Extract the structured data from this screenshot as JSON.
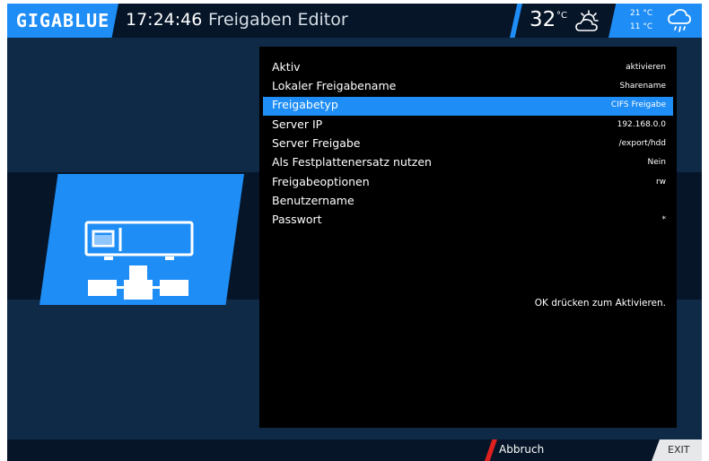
{
  "header": {
    "logo": "GIGABLUE",
    "clock": "17:24:46",
    "title": "Freigaben Editor",
    "temperature": "32",
    "temperature_unit": "°C",
    "forecast_high": "21 °C",
    "forecast_low": "11 °C",
    "weather_icon_current": "sun-cloud-icon",
    "weather_icon_forecast": "rain-cloud-icon"
  },
  "menu": {
    "items": [
      {
        "label": "Aktiv",
        "value": "aktivieren",
        "selected": false
      },
      {
        "label": "Lokaler Freigabename",
        "value": "Sharename",
        "selected": false
      },
      {
        "label": "Freigabetyp",
        "value": "CIFS Freigabe",
        "selected": true
      },
      {
        "label": "Server IP",
        "value": "192.168.0.0",
        "selected": false
      },
      {
        "label": "Server Freigabe",
        "value": "/export/hdd",
        "selected": false
      },
      {
        "label": "Als Festplattenersatz nutzen",
        "value": "Nein",
        "selected": false
      },
      {
        "label": "Freigabeoptionen",
        "value": "rw",
        "selected": false
      },
      {
        "label": "Benutzername",
        "value": "",
        "selected": false
      },
      {
        "label": "Passwort",
        "value": "*",
        "selected": false
      }
    ],
    "help_text": "OK drücken zum Aktivieren."
  },
  "footer": {
    "cancel_label": "Abbruch",
    "exit_label": "EXIT"
  },
  "colors": {
    "accent": "#1e8df5",
    "background": "#0f2a47",
    "panel": "#000000",
    "cancel": "#e02020"
  }
}
